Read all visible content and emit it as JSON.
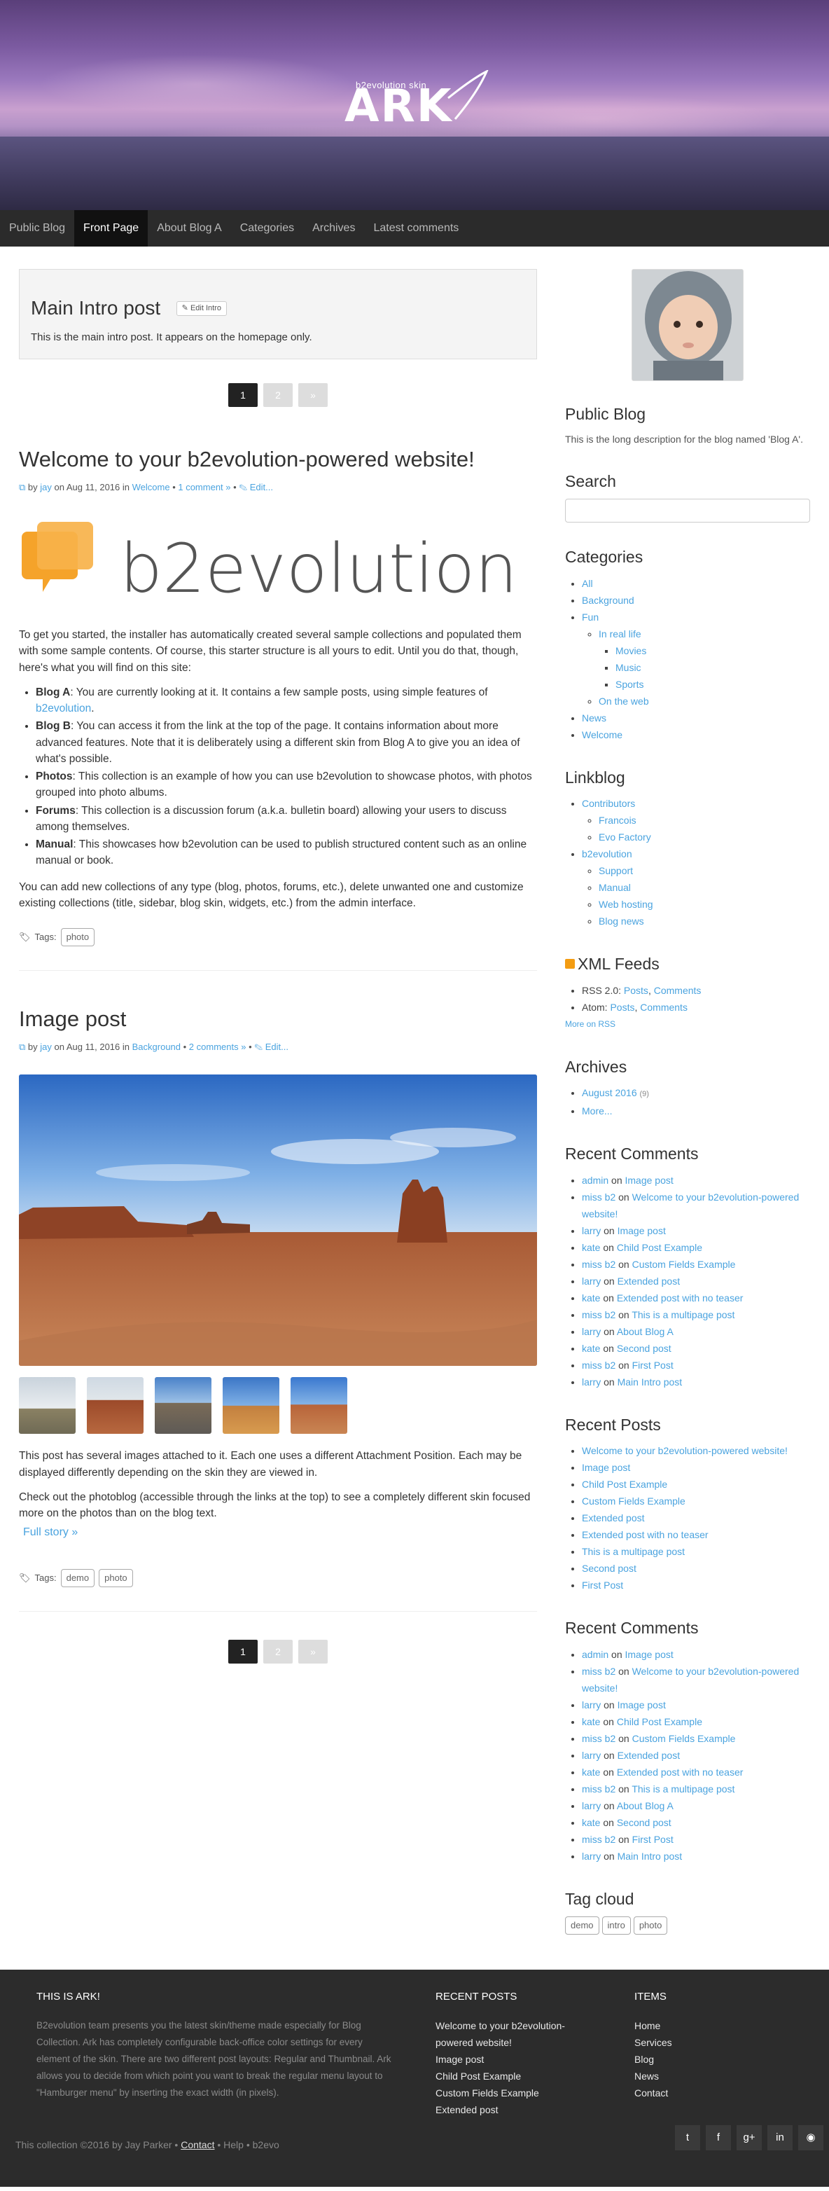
{
  "header": {
    "logo_small": "b2evolution skin",
    "logo_big": "ARK"
  },
  "nav": [
    {
      "label": "Public Blog"
    },
    {
      "label": "Front Page"
    },
    {
      "label": "About Blog A"
    },
    {
      "label": "Categories"
    },
    {
      "label": "Archives"
    },
    {
      "label": "Latest comments"
    }
  ],
  "intro": {
    "title": "Main Intro post",
    "edit_label": "Edit Intro",
    "text": "This is the main intro post. It appears on the homepage only."
  },
  "pager": {
    "current": "1",
    "next": "2",
    "arrow": "»"
  },
  "post1": {
    "title": "Welcome to your b2evolution-powered website!",
    "by": "by",
    "author": "jay",
    "on": "on Aug 11, 2016 in",
    "category": "Welcome",
    "comments": "1 comment »",
    "edit": "Edit...",
    "logo_text": "b2evolution",
    "intro": "To get you started, the installer has automatically created several sample collections and populated them with some sample contents. Of course, this starter structure is all yours to edit. Until you do that, though, here's what you will find on this site:",
    "items": [
      {
        "head": "Blog A",
        "text": ": You are currently looking at it. It contains a few sample posts, using simple features of ",
        "link": "b2evolution",
        "tail": "."
      },
      {
        "head": "Blog B",
        "text": ": You can access it from the link at the top of the page. It contains information about more advanced features. Note that it is deliberately using a different skin from Blog A to give you an idea of what's possible.",
        "link": "",
        "tail": ""
      },
      {
        "head": "Photos",
        "text": ": This collection is an example of how you can use b2evolution to showcase photos, with photos grouped into photo albums.",
        "link": "",
        "tail": ""
      },
      {
        "head": "Forums",
        "text": ": This collection is a discussion forum (a.k.a. bulletin board) allowing your users to discuss among themselves.",
        "link": "",
        "tail": ""
      },
      {
        "head": "Manual",
        "text": ": This showcases how b2evolution can be used to publish structured content such as an online manual or book.",
        "link": "",
        "tail": ""
      }
    ],
    "outro": "You can add new collections of any type (blog, photos, forums, etc.), delete unwanted one and customize existing collections (title, sidebar, blog skin, widgets, etc.) from the admin interface.",
    "tags_label": "Tags:",
    "tags": [
      "photo"
    ]
  },
  "post2": {
    "title": "Image post",
    "by": "by",
    "author": "jay",
    "on": "on Aug 11, 2016 in",
    "category": "Background",
    "comments": "2 comments »",
    "edit": "Edit...",
    "p1": "This post has several images attached to it. Each one uses a different Attachment Position. Each may be displayed differently depending on the skin they are viewed in.",
    "p2": "Check out the photoblog (accessible through the links at the top) to see a completely different skin focused more on the photos than on the blog text.",
    "full_story": "Full story »",
    "tags_label": "Tags:",
    "tags": [
      "demo",
      "photo"
    ]
  },
  "sidebar": {
    "public_blog_title": "Public Blog",
    "public_blog_text": "This is the long description for the blog named 'Blog A'.",
    "search_title": "Search",
    "categories_title": "Categories",
    "categories": {
      "all": "All",
      "background": "Background",
      "fun": "Fun",
      "in_real_life": "In real life",
      "movies": "Movies",
      "music": "Music",
      "sports": "Sports",
      "on_the_web": "On the web",
      "news": "News",
      "welcome": "Welcome"
    },
    "linkblog_title": "Linkblog",
    "linkblog": {
      "contributors": "Contributors",
      "francois": "Francois",
      "evo_factory": "Evo Factory",
      "b2evolution": "b2evolution",
      "support": "Support",
      "manual": "Manual",
      "web_hosting": "Web hosting",
      "blog_news": "Blog news"
    },
    "xml_title": "XML Feeds",
    "xml": {
      "rss_label": "RSS 2.0:",
      "atom_label": "Atom:",
      "posts": "Posts",
      "comments": "Comments",
      "more": "More on RSS"
    },
    "archives_title": "Archives",
    "archives": {
      "month": "August 2016",
      "count": "(9)",
      "more": "More..."
    },
    "recent_comments_title": "Recent Comments",
    "recent_comments": [
      {
        "who": "admin",
        "what": "Image post"
      },
      {
        "who": "miss b2",
        "what": "Welcome to your b2evolution-powered website!"
      },
      {
        "who": "larry",
        "what": "Image post"
      },
      {
        "who": "kate",
        "what": "Child Post Example"
      },
      {
        "who": "miss b2",
        "what": "Custom Fields Example"
      },
      {
        "who": "larry",
        "what": "Extended post"
      },
      {
        "who": "kate",
        "what": "Extended post with no teaser"
      },
      {
        "who": "miss b2",
        "what": "This is a multipage post"
      },
      {
        "who": "larry",
        "what": "About Blog A"
      },
      {
        "who": "kate",
        "what": "Second post"
      },
      {
        "who": "miss b2",
        "what": "First Post"
      },
      {
        "who": "larry",
        "what": "Main Intro post"
      }
    ],
    "on_word": "on",
    "recent_posts_title": "Recent Posts",
    "recent_posts": [
      "Welcome to your b2evolution-powered website!",
      "Image post",
      "Child Post Example",
      "Custom Fields Example",
      "Extended post",
      "Extended post with no teaser",
      "This is a multipage post",
      "Second post",
      "First Post"
    ],
    "tag_cloud_title": "Tag cloud",
    "tag_cloud": [
      "demo",
      "intro",
      "photo"
    ]
  },
  "footer": {
    "col1_title": "THIS IS ARK!",
    "col1_text": "B2evolution team presents you the latest skin/theme made especially for Blog Collection. Ark has completely configurable back-office color settings for every element of the skin. There are two different post layouts: Regular and Thumbnail. Ark allows you to decide from which point you want to break the regular menu layout to \"Hamburger menu\" by inserting the exact width (in pixels).",
    "col2_title": "RECENT POSTS",
    "col2_items": [
      "Welcome to your b2evolution-powered website!",
      "Image post",
      "Child Post Example",
      "Custom Fields Example",
      "Extended post"
    ],
    "col3_title": "ITEMS",
    "col3_items": [
      "Home",
      "Services",
      "Blog",
      "News",
      "Contact"
    ],
    "bottom_prefix": "This collection ©2016 by Jay Parker • ",
    "bottom_contact": "Contact",
    "bottom_suffix": " • Help • b2evo",
    "social_icons": [
      "twitter-icon",
      "facebook-icon",
      "google-plus-icon",
      "linkedin-icon",
      "github-icon"
    ]
  }
}
